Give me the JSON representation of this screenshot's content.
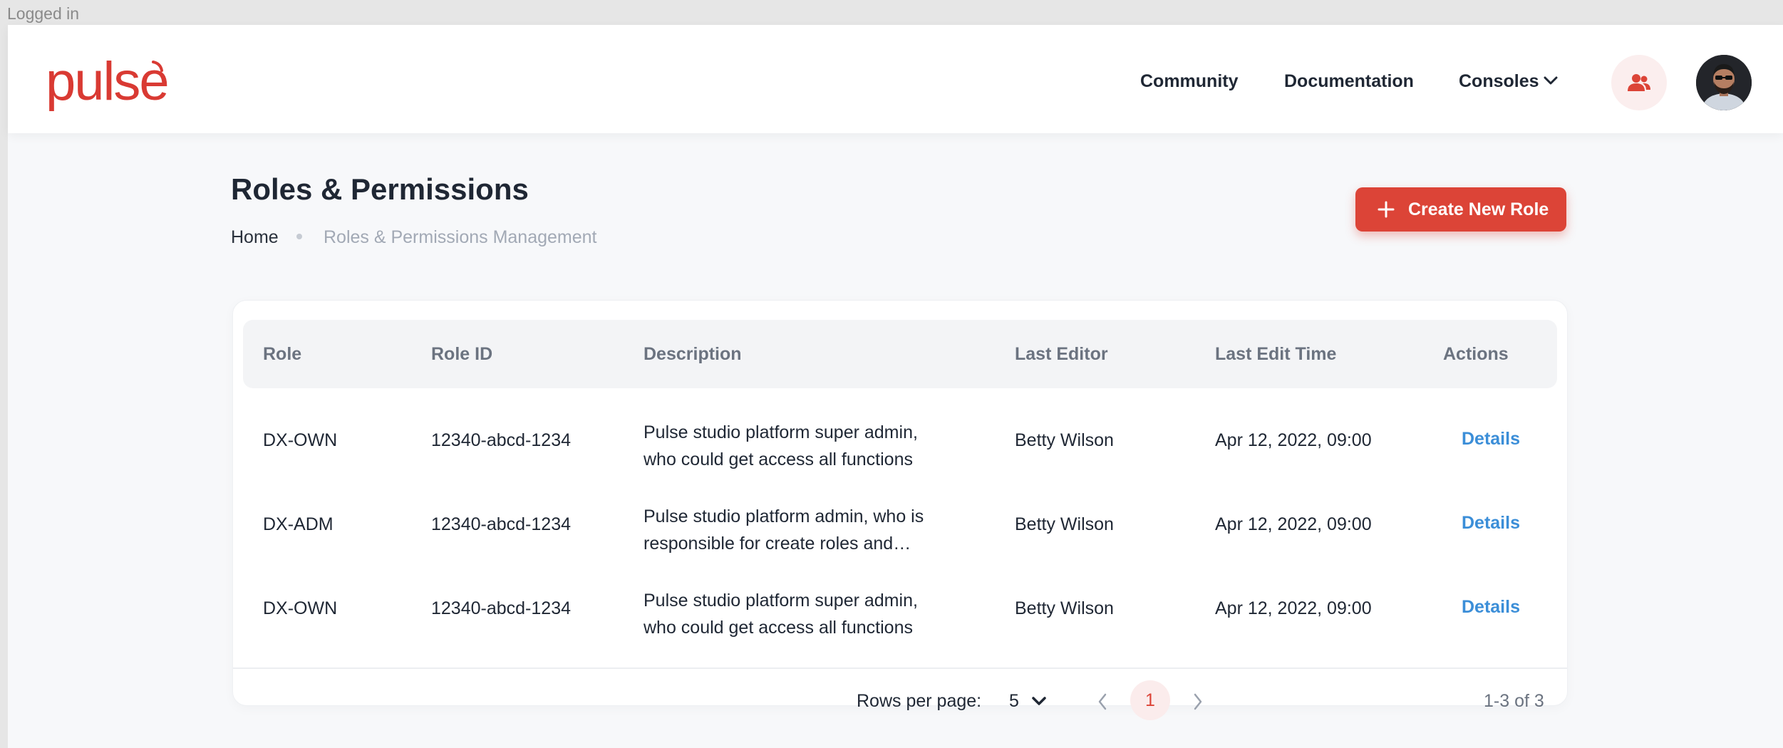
{
  "status_bar": {
    "text": "Logged in"
  },
  "header": {
    "logo": "pulse",
    "nav": [
      "Community",
      "Documentation",
      "Consoles"
    ],
    "users_icon": "users-icon",
    "avatar": "user-avatar"
  },
  "page": {
    "title": "Roles & Permissions",
    "breadcrumb": {
      "home": "Home",
      "current": "Roles & Permissions Management"
    },
    "create_button": "Create New Role"
  },
  "table": {
    "columns": [
      "Role",
      "Role ID",
      "Description",
      "Last Editor",
      "Last Edit Time",
      "Actions"
    ],
    "rows": [
      {
        "role": "DX-OWN",
        "role_id": "12340-abcd-1234",
        "description": "Pulse studio platform super admin, who could get access all functions",
        "editor": "Betty Wilson",
        "time": "Apr 12, 2022, 09:00",
        "action": "Details"
      },
      {
        "role": "DX-ADM",
        "role_id": "12340-abcd-1234",
        "description": "Pulse studio platform admin, who is responsible for create roles and…",
        "editor": "Betty Wilson",
        "time": "Apr 12, 2022, 09:00",
        "action": "Details"
      },
      {
        "role": "DX-OWN",
        "role_id": "12340-abcd-1234",
        "description": "Pulse studio platform super admin, who could get access all functions",
        "editor": "Betty Wilson",
        "time": "Apr 12, 2022, 09:00",
        "action": "Details"
      }
    ],
    "footer": {
      "rows_per_page_label": "Rows per page:",
      "rows_per_page_value": "5",
      "current_page": "1",
      "range": "1-3 of 3"
    }
  },
  "colors": {
    "brand": "#d93a33",
    "primary_button": "#dc4437",
    "link": "#3b8ed8"
  }
}
